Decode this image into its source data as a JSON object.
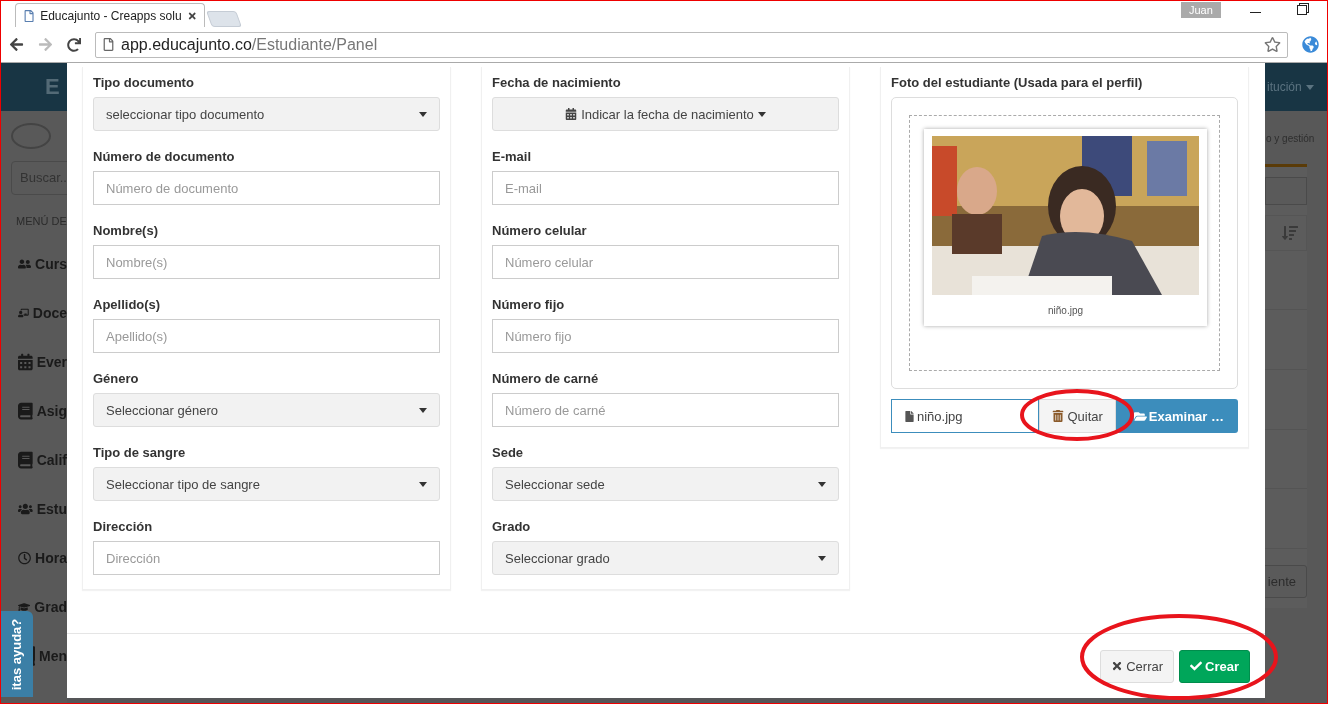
{
  "browser": {
    "tab_title": "Educajunto - Creapps solu",
    "url_host": "app.educajunto.co",
    "url_path": "/Estudiante/Panel",
    "user": "Juan"
  },
  "background": {
    "brand": "E",
    "header_menu": "itución",
    "subtitle": "o y gestión",
    "search_placeholder": "Buscar..",
    "menu_heading": "MENÚ DE",
    "menu": [
      {
        "label": "Curs"
      },
      {
        "label": "Doce"
      },
      {
        "label": "Ever"
      },
      {
        "label": "Asig"
      },
      {
        "label": "Calif"
      },
      {
        "label": "Estu"
      },
      {
        "label": "Hora"
      },
      {
        "label": "Grad"
      },
      {
        "label": "Men"
      }
    ],
    "right_button": "iente",
    "help_tab": "itas ayuda?"
  },
  "modal": {
    "columns": [
      {
        "fields": [
          {
            "label": "Tipo documento",
            "kind": "select",
            "value": "seleccionar tipo documento"
          },
          {
            "label": "Número de documento",
            "kind": "input",
            "placeholder": "Número de documento"
          },
          {
            "label": "Nombre(s)",
            "kind": "input",
            "placeholder": "Nombre(s)"
          },
          {
            "label": "Apellido(s)",
            "kind": "input",
            "placeholder": "Apellido(s)"
          },
          {
            "label": "Género",
            "kind": "select",
            "value": "Seleccionar género"
          },
          {
            "label": "Tipo de sangre",
            "kind": "select",
            "value": "Seleccionar tipo de sangre"
          },
          {
            "label": "Dirección",
            "kind": "input",
            "placeholder": "Dirección"
          }
        ]
      },
      {
        "fields": [
          {
            "label": "Fecha de nacimiento",
            "kind": "date",
            "value": "Indicar la fecha de nacimiento"
          },
          {
            "label": "E-mail",
            "kind": "input",
            "placeholder": "E-mail"
          },
          {
            "label": "Número celular",
            "kind": "input",
            "placeholder": "Número celular"
          },
          {
            "label": "Número fijo",
            "kind": "input",
            "placeholder": "Número fijo"
          },
          {
            "label": "Número de carné",
            "kind": "input",
            "placeholder": "Número de carné"
          },
          {
            "label": "Sede",
            "kind": "select",
            "value": "Seleccionar sede"
          },
          {
            "label": "Grado",
            "kind": "select",
            "value": "Seleccionar grado"
          }
        ]
      }
    ],
    "photo": {
      "title": "Foto del estudiante (Usada para el perfil)",
      "caption": "niño.jpg",
      "file_name": "niño.jpg",
      "remove": "Quitar",
      "browse": "Examinar …"
    },
    "buttons": [
      {
        "label": "Cerrar",
        "kind": "close"
      },
      {
        "label": "Crear",
        "kind": "create"
      }
    ]
  }
}
